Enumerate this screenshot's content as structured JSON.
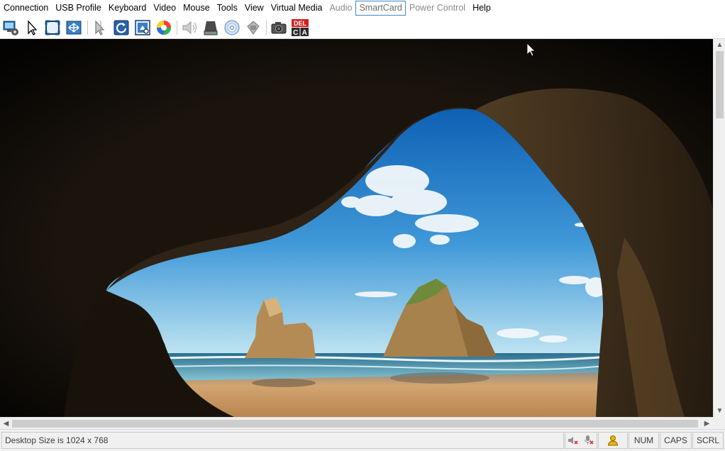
{
  "menu": [
    {
      "label": "Connection",
      "state": "normal"
    },
    {
      "label": "USB Profile",
      "state": "normal"
    },
    {
      "label": "Keyboard",
      "state": "normal"
    },
    {
      "label": "Video",
      "state": "normal"
    },
    {
      "label": "Mouse",
      "state": "normal"
    },
    {
      "label": "Tools",
      "state": "normal"
    },
    {
      "label": "View",
      "state": "normal"
    },
    {
      "label": "Virtual Media",
      "state": "normal"
    },
    {
      "label": "Audio",
      "state": "disabled"
    },
    {
      "label": "SmartCard",
      "state": "active"
    },
    {
      "label": "Power Control",
      "state": "disabled"
    },
    {
      "label": "Help",
      "state": "normal"
    }
  ],
  "toolbar": {
    "icons": [
      "connection-properties-icon",
      "single-cursor-icon",
      "full-screen-icon",
      "fit-to-screen-icon",
      "align-cursor-icon",
      "refresh-video-icon",
      "auto-sense-video-icon",
      "color-calibrate-icon",
      "audio-speaker-icon",
      "virtual-drive-icon",
      "virtual-cd-icon",
      "smartcard-icon",
      "screenshot-camera-icon",
      "ctrl-alt-del-icon"
    ],
    "ctrl_alt_del": {
      "top": "DEL",
      "left": "C",
      "right": "A"
    }
  },
  "status": {
    "message": "Desktop Size is 1024 x 768",
    "num": "NUM",
    "caps": "CAPS",
    "scrl": "SCRL"
  },
  "colors": {
    "active_menu_border": "#3f86c9",
    "sky": "#1d74c4",
    "sand": "#c4955e",
    "sea": "#3b8fae"
  }
}
